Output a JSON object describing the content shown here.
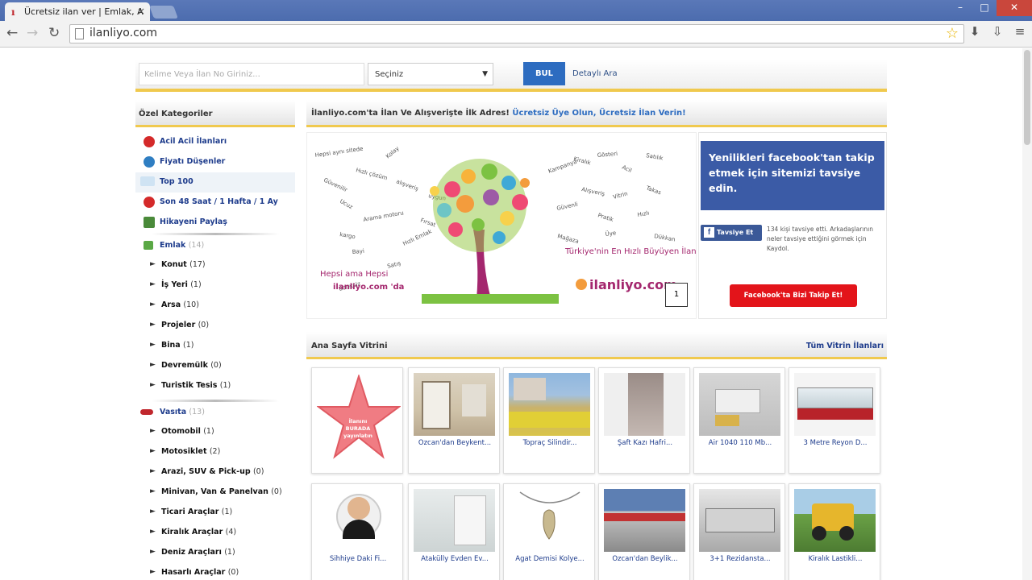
{
  "browser": {
    "tab_title": "Ücretsiz ilan ver | Emlak, A",
    "tab_close": "×",
    "url": "ilanliyo.com",
    "controls": [
      "–",
      "□",
      "✕"
    ]
  },
  "search": {
    "placeholder": "Kelime Veya İlan No Giriniz...",
    "select_value": "Seçiniz",
    "button": "BUL",
    "advanced": "Detaylı Ara"
  },
  "left": {
    "title": "Özel Kategoriler",
    "special": [
      {
        "label": "Acil Acil İlanları",
        "icon_color": "#d42a2a"
      },
      {
        "label": "Fiyatı Düşenler",
        "icon_color": "#2f7ec2"
      },
      {
        "label": "Top 100",
        "icon_color": "#cfe3f3"
      },
      {
        "label": "Son 48 Saat / 1 Hafta / 1 Ay",
        "icon_color": "#d42a2a"
      },
      {
        "label": "Hikayeni Paylaş",
        "icon_color": "#4a8a3a"
      }
    ],
    "emlak": {
      "label": "Emlak",
      "count": "(14)"
    },
    "emlak_items": [
      {
        "label": "Konut",
        "count": "(17)"
      },
      {
        "label": "İş Yeri",
        "count": "(1)"
      },
      {
        "label": "Arsa",
        "count": "(10)"
      },
      {
        "label": "Projeler",
        "count": "(0)"
      },
      {
        "label": "Bina",
        "count": "(1)"
      },
      {
        "label": "Devremülk",
        "count": "(0)"
      },
      {
        "label": "Turistik Tesis",
        "count": "(1)"
      }
    ],
    "vasita": {
      "label": "Vasıta",
      "count": "(13)"
    },
    "vasita_items": [
      {
        "label": "Otomobil",
        "count": "(1)"
      },
      {
        "label": "Motosiklet",
        "count": "(2)"
      },
      {
        "label": "Arazi, SUV & Pick-up",
        "count": "(0)"
      },
      {
        "label": "Minivan, Van & Panelvan",
        "count": "(0)"
      },
      {
        "label": "Ticari Araçlar",
        "count": "(1)"
      },
      {
        "label": "Kiralık Araçlar",
        "count": "(4)"
      },
      {
        "label": "Deniz Araçları",
        "count": "(1)"
      },
      {
        "label": "Hasarlı Araçlar",
        "count": "(0)"
      }
    ]
  },
  "main": {
    "welcome_a": "İlanliyo.com'ta İlan Ve Alışverişte İlk Adres!",
    "welcome_b": "Ücretsiz Üye Olun, Ücretsiz İlan Verin!",
    "banner": {
      "slogan_right": "Türkiye'nin En Hızlı Büyüyen İlan Sitesinde Yerinizi Alın.",
      "slogan_left_a": "Hepsi ama Hepsi",
      "slogan_left_b": "ilanliyo.com 'da",
      "logo": "ilanliyo.com",
      "page": "1"
    },
    "facebook": {
      "text": "Yenilikleri facebook'tan takip etmek için sitemizi tavsiye edin.",
      "like": "Tavsiye Et",
      "small": "134 kişi tavsiye etti. Arkadaşlarının neler tavsiye ettiğini görmek için Kaydol.",
      "follow": "Facebook'ta Bizi Takip Et!"
    },
    "showcase_title": "Ana Sayfa Vitrini",
    "showcase_all": "Tüm Vitrin İlanları",
    "star_card_text": "İlanını BURADA yayınlatın",
    "cards_row1": [
      "",
      "Özcan'dan Beykent...",
      "Topraç Silindir...",
      "Şaft Kazı Hafri...",
      "Air 1040 110 Mb...",
      "3 Metre Reyon D..."
    ],
    "cards_row2": [
      "Sihhiye Daki Fi...",
      "Atakülly Evden Ev...",
      "Agat Demisi Kolye...",
      "Özcan'dan Beylik...",
      "3+1 Rezidansta...",
      "Kiralık Lastikli..."
    ]
  }
}
